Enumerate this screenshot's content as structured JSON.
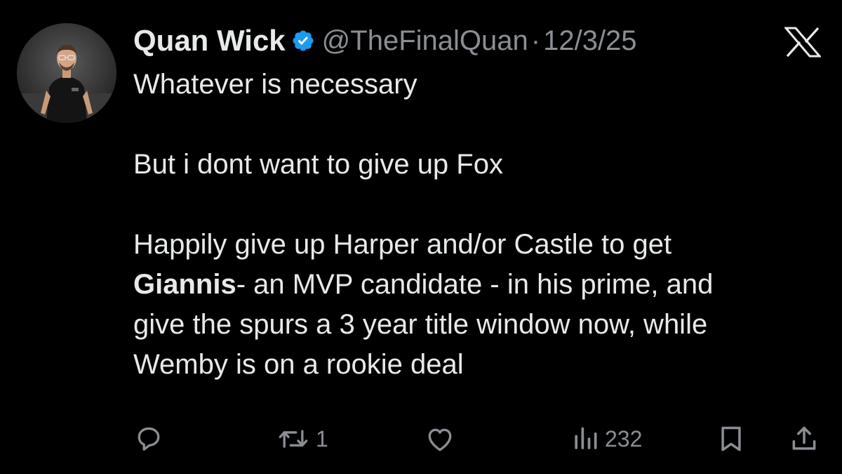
{
  "author": {
    "name": "Quan Wick",
    "handle": "@TheFinalQuan",
    "separator": "·",
    "date": "12/3/25",
    "verified": true
  },
  "tweet": {
    "line1": "Whatever is necessary",
    "line2": "But i dont want to give up Fox",
    "line3": "Happily give up Harper and/or Castle to get",
    "bold_word": "Giannis",
    "line4_rest": "- an MVP candidate - in his prime, and",
    "line5": "give the spurs a 3 year title window now, while",
    "line6": "Wemby is on a rookie deal"
  },
  "actions": {
    "reply_icon": "speech-bubble-icon",
    "retweet_icon": "retweet-arrows-icon",
    "retweet_count": "1",
    "like_icon": "heart-icon",
    "views_icon": "bar-chart-icon",
    "views_count": "232",
    "bookmark_icon": "bookmark-icon",
    "share_icon": "upload-icon"
  },
  "colors": {
    "background": "#000000",
    "text": "#e7e9ea",
    "muted": "#8b8f94",
    "verified_blue": "#1d9bf0"
  }
}
